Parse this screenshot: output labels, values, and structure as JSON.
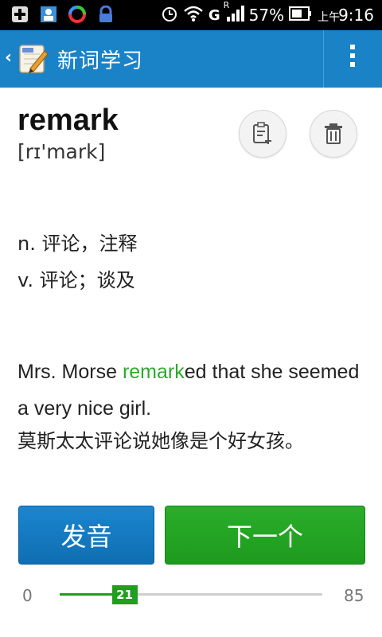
{
  "status_bar": {
    "network_letter": "G",
    "roaming_letter": "R",
    "battery": "57%",
    "time_prefix": "上午",
    "time": "9:16"
  },
  "action_bar": {
    "back_symbol": "‹",
    "title": "新词学习"
  },
  "word": {
    "text": "remark",
    "phonetic": "[rɪ'mark]"
  },
  "definitions": [
    "n. 评论，注释",
    "v. 评论；谈及"
  ],
  "example": {
    "prefix": "Mrs. Morse ",
    "highlight": "remark",
    "suffix": "ed that she seemed a very nice girl.",
    "translation": "莫斯太太评论说她像是个好女孩。"
  },
  "buttons": {
    "pronounce": "发音",
    "next": "下一个"
  },
  "progress": {
    "min": "0",
    "max": "85",
    "current": "21",
    "current_value": 21,
    "max_value": 85
  },
  "colors": {
    "primary_blue": "#1a83c8",
    "accent_green": "#1f9e1f",
    "button_blue": "#1478bf"
  }
}
